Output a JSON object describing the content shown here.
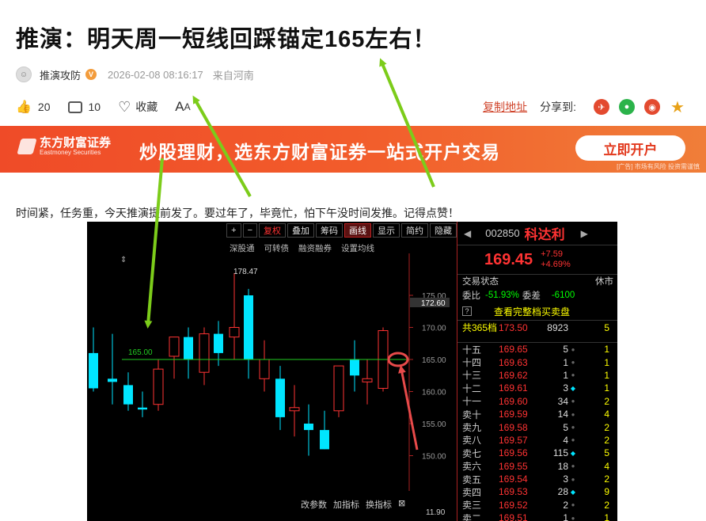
{
  "article": {
    "title": "推演：明天周一短线回踩锚定165左右！",
    "author": "推演攻防",
    "verified_badge": "V",
    "date": "2026-02-08 08:16:17",
    "source": "来自河南",
    "likes": "20",
    "comments": "10",
    "favorite_label": "收藏",
    "font_label": "A",
    "font_label_small": "A",
    "copy_link": "复制地址",
    "share_label": "分享到:",
    "body": "时间紧，任务重，今天推演提前发了。要过年了，毕竟忙，怕下午没时间发推。记得点赞！"
  },
  "banner": {
    "brand": "东方财富证券",
    "brand_en": "Eastmoney Securities",
    "slogan": "炒股理财，选东方财富证券一站式开户交易",
    "cta": "立即开户",
    "disclaimer": "[广告] 市场有风险 投资需谨慎"
  },
  "trading": {
    "toolbar": [
      "复权",
      "叠加",
      "筹码",
      "画线",
      "显示",
      "简约",
      "隐藏"
    ],
    "toolbar_icons": [
      "+",
      "−"
    ],
    "subbar": [
      "深股通",
      "可转债",
      "融资融券",
      "设置均线"
    ],
    "bottombar": [
      "改参数",
      "加指标",
      "换指标"
    ],
    "bottom_price": "11.90",
    "chart_labels": {
      "high": "178.47",
      "line": "165.00",
      "current": "172.60"
    },
    "axis_ticks": [
      "175.00",
      "170.00",
      "165.00",
      "160.00",
      "155.00",
      "150.00"
    ],
    "stock": {
      "code": "002850",
      "name": "科达利",
      "price": "169.45",
      "change": "+7.59",
      "change_pct": "+4.69%"
    },
    "status": {
      "label": "交易状态",
      "value": "休市"
    },
    "ratio": {
      "label1": "委比",
      "value1": "-51.93%",
      "label2": "委差",
      "value2": "-6100"
    },
    "view_all": "查看完整档买卖盘",
    "view_icon": "?",
    "total": {
      "label": "共365档",
      "price": "173.50",
      "volume": "8923",
      "count": "5"
    },
    "orders": [
      {
        "level": "十五",
        "price": "169.65",
        "vol": "5",
        "count": "1",
        "marker": "grey"
      },
      {
        "level": "十四",
        "price": "169.63",
        "vol": "1",
        "count": "1",
        "marker": "grey"
      },
      {
        "level": "十三",
        "price": "169.62",
        "vol": "1",
        "count": "1",
        "marker": "grey"
      },
      {
        "level": "十二",
        "price": "169.61",
        "vol": "3",
        "count": "1",
        "marker": "cyan"
      },
      {
        "level": "十一",
        "price": "169.60",
        "vol": "34",
        "count": "2",
        "marker": "grey"
      },
      {
        "level": "卖十",
        "price": "169.59",
        "vol": "14",
        "count": "4",
        "marker": "grey"
      },
      {
        "level": "卖九",
        "price": "169.58",
        "vol": "5",
        "count": "2",
        "marker": "grey"
      },
      {
        "level": "卖八",
        "price": "169.57",
        "vol": "4",
        "count": "2",
        "marker": "grey"
      },
      {
        "level": "卖七",
        "price": "169.56",
        "vol": "115",
        "count": "5",
        "marker": "cyan"
      },
      {
        "level": "卖六",
        "price": "169.55",
        "vol": "18",
        "count": "4",
        "marker": "grey"
      },
      {
        "level": "卖五",
        "price": "169.54",
        "vol": "3",
        "count": "2",
        "marker": "grey"
      },
      {
        "level": "卖四",
        "price": "169.53",
        "vol": "28",
        "count": "9",
        "marker": "cyan"
      },
      {
        "level": "卖三",
        "price": "169.52",
        "vol": "2",
        "count": "2",
        "marker": "grey"
      },
      {
        "level": "卖二",
        "price": "169.51",
        "vol": "1",
        "count": "1",
        "marker": "grey"
      }
    ]
  },
  "colors": {
    "accent": "#ef4b28",
    "up": "#ff3333",
    "down": "#00e5ff",
    "line": "#22cc22",
    "arrow_green": "#7ccc1a",
    "arrow_red": "#e84a4a"
  }
}
